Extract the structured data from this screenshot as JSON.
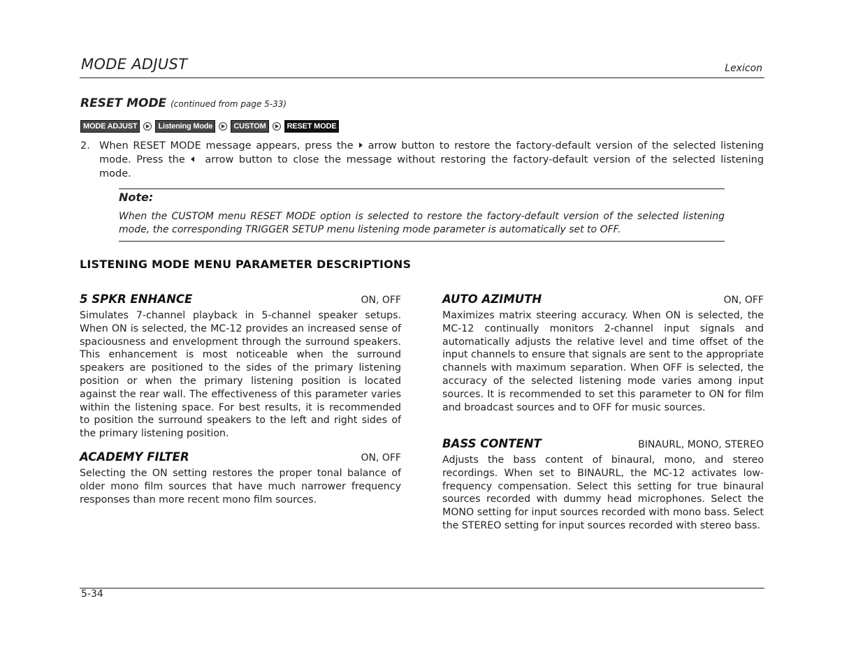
{
  "header": {
    "title": "MODE ADJUST",
    "brand": "Lexicon"
  },
  "section": {
    "title": "RESET MODE",
    "continued": "(continued from page 5-33)"
  },
  "breadcrumb": [
    {
      "label": "MODE ADJUST"
    },
    {
      "label": "Listening Mode"
    },
    {
      "label": "CUSTOM"
    },
    {
      "label": "RESET MODE"
    }
  ],
  "step": {
    "number": "2.",
    "part1": "When RESET MODE message appears, press the",
    "right_arrow_icon": "right-arrow",
    "part2": "arrow button to restore the factory-default version of the selected listening mode. Press the",
    "left_arrow_icon": "left-arrow",
    "part3": "arrow button to close the message without restoring the factory-default version of the selected listening mode."
  },
  "note": {
    "title": "Note:",
    "body": "When the CUSTOM menu RESET MODE option is selected to restore the factory-default version of the selected listening mode, the corresponding TRIGGER SETUP menu listening mode parameter is automatically set to OFF."
  },
  "descriptions": {
    "title": "LISTENING MODE MENU PARAMETER DESCRIPTIONS",
    "left": [
      {
        "name": "5 SPKR ENHANCE",
        "options": "ON, OFF",
        "text": "Simulates 7-channel playback in 5-channel speaker setups. When ON is selected, the MC-12 provides an increased sense of spaciousness and envelopment through the surround speakers. This enhancement is most noticeable when the surround speakers are positioned to the sides of the primary listening position or when the primary listening position is located against the rear wall. The effectiveness of this parameter varies within the listening space. For best results, it is recommended to position the surround speakers to the left and right sides of the primary listening position."
      },
      {
        "name": "ACADEMY FILTER",
        "options": "ON, OFF",
        "text": "Selecting the ON setting restores the proper tonal balance of older mono film sources that have much narrower frequency responses than more recent mono film sources."
      }
    ],
    "right": [
      {
        "name": "AUTO AZIMUTH",
        "options": "ON, OFF",
        "text": "Maximizes matrix steering accuracy. When ON is selected, the MC-12 continually monitors 2-channel input signals and automatically adjusts the relative level and time offset of the input channels to ensure that signals are sent to the appropriate channels with maximum separation. When OFF is selected, the accuracy of the selected listening mode varies among input sources. It is recommended to set this parameter to ON for film and broadcast sources and to OFF for music sources."
      },
      {
        "name": "BASS CONTENT",
        "options": "BINAURL, MONO, STEREO",
        "text": "Adjusts the bass content of binaural, mono, and stereo recordings. When set to BINAURL, the MC-12 activates low-frequency compensation. Select this setting for true binaural sources recorded with dummy head microphones. Select the MONO setting for input sources recorded with mono bass. Select the STEREO setting for input sources recorded with stereo bass."
      }
    ]
  },
  "footer": {
    "page_number": "5-34"
  }
}
